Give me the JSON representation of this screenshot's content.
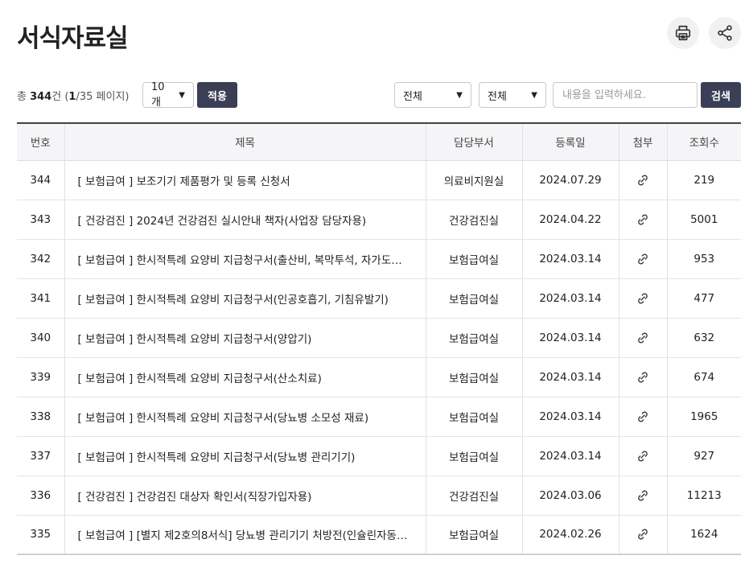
{
  "page": {
    "title": "서식자료실"
  },
  "actions": {
    "print_icon": "printer-icon",
    "share_icon": "share-icon"
  },
  "summary": {
    "prefix": "총 ",
    "total": "344",
    "unit": "건 (",
    "current_page": "1",
    "separator": "/",
    "total_pages": "35",
    "suffix": " 페이지)"
  },
  "filters": {
    "page_size": "10개",
    "apply_label": "적용",
    "category_1": "전체",
    "category_2": "전체",
    "search_placeholder": "내용을 입력하세요.",
    "search_label": "검색"
  },
  "table": {
    "headers": [
      "번호",
      "제목",
      "담당부서",
      "등록일",
      "첨부",
      "조회수"
    ],
    "rows": [
      {
        "no": "344",
        "title": "[ 보험급여 ] 보조기기 제품평가 및 등록 신청서",
        "dept": "의료비지원실",
        "date": "2024.07.29",
        "views": "219"
      },
      {
        "no": "343",
        "title": "[ 건강검진 ] 2024년 건강검진 실시안내 책자(사업장 담당자용)",
        "dept": "건강검진실",
        "date": "2024.04.22",
        "views": "5001"
      },
      {
        "no": "342",
        "title": "[ 보험급여 ] 한시적특례 요양비 지급청구서(출산비, 복막투석, 자가도뇨, ...",
        "dept": "보험급여실",
        "date": "2024.03.14",
        "views": "953"
      },
      {
        "no": "341",
        "title": "[ 보험급여 ] 한시적특례 요양비 지급청구서(인공호흡기, 기침유발기)",
        "dept": "보험급여실",
        "date": "2024.03.14",
        "views": "477"
      },
      {
        "no": "340",
        "title": "[ 보험급여 ] 한시적특례 요양비 지급청구서(양압기)",
        "dept": "보험급여실",
        "date": "2024.03.14",
        "views": "632"
      },
      {
        "no": "339",
        "title": "[ 보험급여 ] 한시적특례 요양비 지급청구서(산소치료)",
        "dept": "보험급여실",
        "date": "2024.03.14",
        "views": "674"
      },
      {
        "no": "338",
        "title": "[ 보험급여 ] 한시적특례 요양비 지급청구서(당뇨병 소모성 재료)",
        "dept": "보험급여실",
        "date": "2024.03.14",
        "views": "1965"
      },
      {
        "no": "337",
        "title": "[ 보험급여 ] 한시적특례 요양비 지급청구서(당뇨병 관리기기)",
        "dept": "보험급여실",
        "date": "2024.03.14",
        "views": "927"
      },
      {
        "no": "336",
        "title": "[ 건강검진 ] 건강검진 대상자 확인서(직장가입자용)",
        "dept": "건강검진실",
        "date": "2024.03.06",
        "views": "11213"
      },
      {
        "no": "335",
        "title": "[ 보험급여 ] [별지 제2호의8서식] 당뇨병 관리기기 처방전(인슐린자동주...",
        "dept": "보험급여실",
        "date": "2024.02.26",
        "views": "1624"
      }
    ],
    "attachment_icon": "paperclip-icon"
  }
}
